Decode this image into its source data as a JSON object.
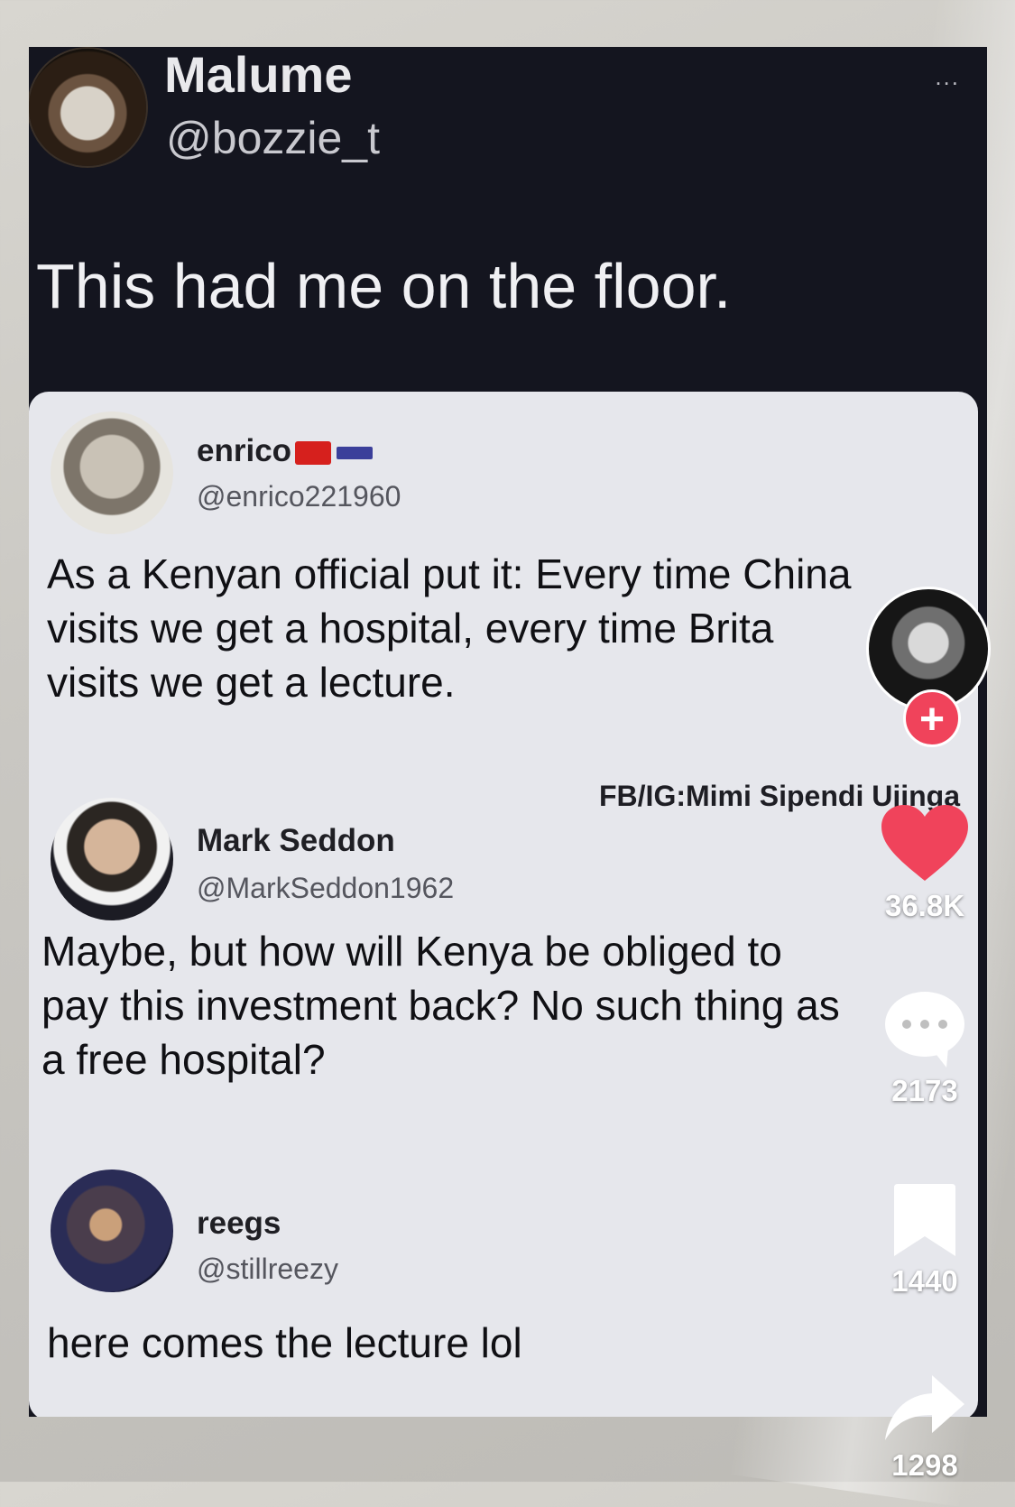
{
  "tweet": {
    "display_name": "Malume",
    "handle": "@bozzie_t",
    "more": "...",
    "text": "This had me on the floor."
  },
  "quoted": {
    "posts": [
      {
        "name": "enrico",
        "handle": "@enrico221960",
        "text_lines": [
          "As a Kenyan official put it: Every time China",
          "visits we get a hospital, every time Brita",
          "visits we get a lecture."
        ]
      },
      {
        "name": "Mark Seddon",
        "handle": "@MarkSeddon1962",
        "text_lines": [
          "Maybe, but how will Kenya be obliged to",
          "pay this investment back? No such thing as",
          "a free hospital?"
        ]
      },
      {
        "name": "reegs",
        "handle": "@stillreezy",
        "text_lines": [
          "here comes the lecture lol"
        ]
      }
    ],
    "watermark": "FB/IG:Mimi Sipendi Ujinga"
  },
  "rail": {
    "follow_label": "+",
    "likes": "36.8K",
    "comments": "2173",
    "saves": "1440",
    "shares": "1298"
  },
  "colors": {
    "like": "#f0435b",
    "follow": "#f0435b",
    "dark_bg": "#14151f",
    "quote_bg": "#e6e7ec"
  },
  "icons": [
    "heart-icon",
    "comment-icon",
    "bookmark-icon",
    "share-icon",
    "more-icon"
  ]
}
